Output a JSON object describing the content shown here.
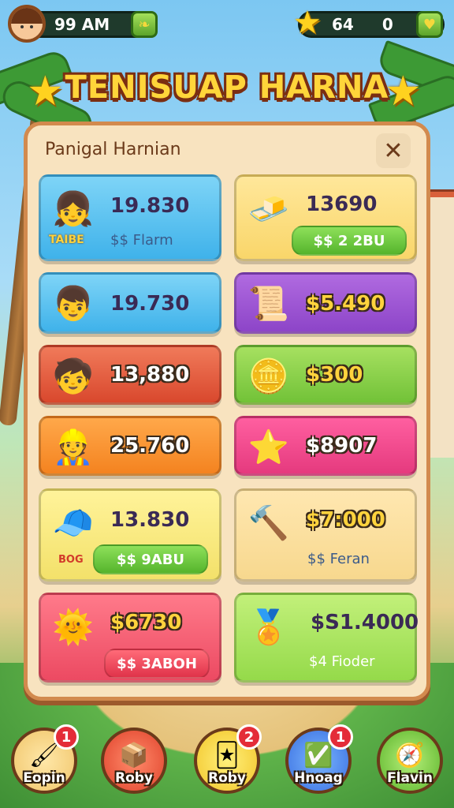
{
  "topbar": {
    "time": "99 AM",
    "stars_count": "64",
    "coins_count": "0"
  },
  "title": "TENISUAP HARNA",
  "panel": {
    "title": "Panigal Harnian",
    "close_icon": "close-icon"
  },
  "cards": [
    {
      "price": "19.830",
      "sub": "$$ Flarm",
      "tag": "TAIBE",
      "icon": "character-girl"
    },
    {
      "price": "13690",
      "button": "$$ 2 2BU",
      "icon": "gold-bars"
    },
    {
      "price": "19.730",
      "icon": "character-boy-green-cap"
    },
    {
      "price": "$5.490",
      "icon": "blue-scroll"
    },
    {
      "price": "13,880",
      "icon": "character-boy-brown-cap"
    },
    {
      "price": "$300",
      "icon": "gold-coin"
    },
    {
      "price": "25.760",
      "icon": "character-boy-yellow-cap"
    },
    {
      "price": "$8907",
      "icon": "gold-star"
    },
    {
      "price": "13.830",
      "button": "$$ 9ABU",
      "tag": "BOG",
      "icon": "character-boy-red-cap"
    },
    {
      "price": "$7:000",
      "sub": "$$ Feran",
      "icon": "hammer"
    },
    {
      "price": "$6730",
      "button": "$$ 3ABOH",
      "icon": "sun-medal"
    },
    {
      "price": "$S1.4000",
      "sub": "$4 Fioder",
      "icon": "coin-medal"
    }
  ],
  "nav": [
    {
      "label": "Eopin",
      "badge": "1",
      "icon": "brush-icon"
    },
    {
      "label": "Roby",
      "icon": "chest-icon"
    },
    {
      "label": "Roby",
      "badge": "2",
      "icon": "card-icon"
    },
    {
      "label": "Hnoag",
      "badge": "1",
      "icon": "check-icon"
    },
    {
      "label": "Flavin",
      "icon": "compass-icon"
    }
  ]
}
